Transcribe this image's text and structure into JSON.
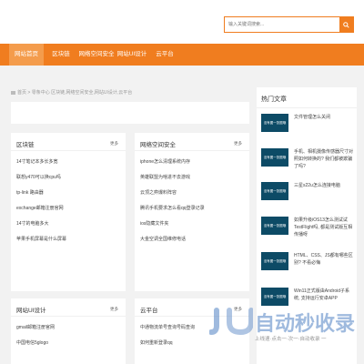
{
  "search": {
    "placeholder": "输入关键词搜索..."
  },
  "nav": [
    "网站首页",
    "区块链",
    "网络空间安全",
    "网站UI设计",
    "云平台"
  ],
  "breadcrumb": "首页 > 零条中心 区块链,网络空间安全,网站UI设计,云平台",
  "more_label": "更多",
  "hot": {
    "title": "热门文章",
    "thumb_text": "没有图一张图哦",
    "items": [
      "文件管理怎么关闭",
      "手机、相机摄像传感器尺寸对照如何转换的? 我们都被欺骗了吗?",
      "三星s22u怎么连接电脑",
      "如果升级iOS13怎么测试试TestFlight吗, 都是测试版互相传播呀",
      "HTML、CSS、JS都有哪些区别? 不看必悔",
      "Win11正式版由Android子系统, 支持运行安卓APP"
    ]
  },
  "sections": {
    "blockchain": {
      "title": "区块链",
      "items": [
        "14寸笔记本多长多宽",
        "联想y470可以换cpu吗",
        "tp-link 路由器",
        "exchange邮箱注册官网",
        "14寸的电脑多大",
        "苹果手机屏幕是什么屏幕"
      ]
    },
    "security": {
      "title": "网络空间安全",
      "items": [
        "iphone怎么清理系统内存",
        "英雄联盟为啥进不去游戏",
        "云顶之弈爆料阵容",
        "腾讯手机要求怎么看qq登录记录",
        "ios隐藏文件夹",
        "大金空调全国维修电话"
      ]
    },
    "ui": {
      "title": "网站UI设计",
      "items": [
        "gmail邮箱注册官网",
        "中国电信5glogo"
      ]
    },
    "cloud": {
      "title": "云平台",
      "items": [
        "中通物流单号查询号码查询",
        "如何重新登录qq"
      ]
    }
  },
  "watermark": {
    "text": "自动秒收录",
    "sub": "上线速·点击一·次一·自动收录 一"
  },
  "colors": {
    "brand": "#f07d1f",
    "nav_active": "#f49c4c",
    "thumb": "#0d4b66"
  }
}
